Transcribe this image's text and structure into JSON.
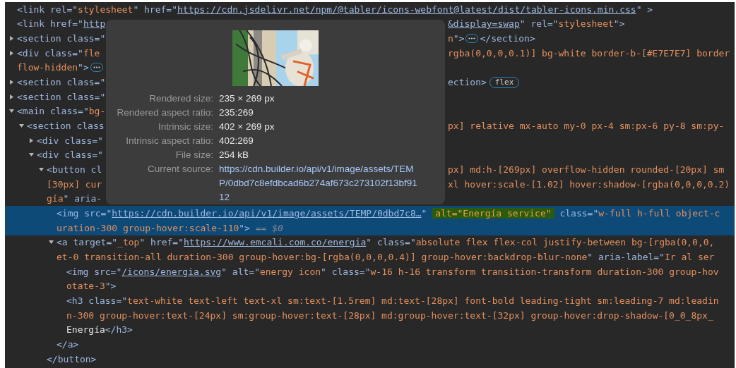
{
  "elements": [
    {
      "selected": false,
      "lines": [
        {
          "tokens": [
            {
              "kind": "markup",
              "text": "<link rel=\""
            },
            {
              "kind": "value",
              "text": "stylesheet"
            },
            {
              "kind": "markup",
              "text": "\" href=\""
            },
            {
              "kind": "link",
              "text": "https://cdn.jsdelivr.net/npm/@tabler/icons-webfont@latest/dist/tabler-icons.min.css"
            },
            {
              "kind": "markup",
              "text": "\" >"
            }
          ]
        }
      ]
    },
    {
      "selected": false,
      "lines": [
        {
          "left": [
            {
              "kind": "markup",
              "text": "<link href=\""
            },
            {
              "kind": "link",
              "text": "http"
            }
          ],
          "right": [
            {
              "kind": "link",
              "text": "&display=swap"
            },
            {
              "kind": "markup",
              "text": "\" rel=\""
            },
            {
              "kind": "value",
              "text": "stylesheet"
            },
            {
              "kind": "markup",
              "text": "\">"
            }
          ]
        }
      ]
    },
    {
      "selected": false,
      "expanded": false,
      "lines": [
        {
          "left": [
            {
              "kind": "markup",
              "text": "<section class=\""
            }
          ],
          "right": [
            {
              "kind": "value",
              "text": "n"
            },
            {
              "kind": "markup",
              "text": "\">"
            },
            {
              "kind": "more"
            },
            {
              "kind": "markup",
              "text": "</section>"
            }
          ]
        }
      ]
    },
    {
      "selected": false,
      "expanded": false,
      "lines": [
        {
          "left": [
            {
              "kind": "markup",
              "text": "<div class=\""
            },
            {
              "kind": "value",
              "text": "fle"
            }
          ],
          "right": [
            {
              "kind": "value",
              "text": "rgba(0,0,0,0.1)] bg-white border-b-[#E7E7E7] border"
            }
          ]
        },
        {
          "tokens": [
            {
              "kind": "value",
              "text": "flow-hidden"
            },
            {
              "kind": "markup",
              "text": "\">"
            },
            {
              "kind": "more"
            }
          ]
        }
      ]
    },
    {
      "selected": false,
      "expanded": false,
      "lines": [
        {
          "left": [
            {
              "kind": "markup",
              "text": "<section class=\""
            }
          ],
          "right": [
            {
              "kind": "markup",
              "text": "ection>"
            },
            {
              "kind": "badge",
              "text": "flex"
            }
          ]
        }
      ]
    },
    {
      "selected": false,
      "expanded": false,
      "lines": [
        {
          "left": [
            {
              "kind": "markup",
              "text": "<section class=\""
            }
          ]
        }
      ]
    },
    {
      "selected": false,
      "expanded": true,
      "lines": [
        {
          "left": [
            {
              "kind": "markup",
              "text": "<main class=\""
            },
            {
              "kind": "value",
              "text": "bg-"
            }
          ]
        }
      ],
      "children": [
        {
          "selected": false,
          "expanded": true,
          "lines": [
            {
              "left": [
                {
                  "kind": "markup",
                  "text": "<section class"
                }
              ],
              "right": [
                {
                  "kind": "value",
                  "text": "px] relative mx-auto my-0 px-4 sm:px-6 py-8 sm:py-"
                }
              ]
            }
          ],
          "children": [
            {
              "selected": false,
              "expanded": false,
              "lines": [
                {
                  "left": [
                    {
                      "kind": "markup",
                      "text": "<div class=\""
                    }
                  ]
                }
              ]
            },
            {
              "selected": false,
              "expanded": true,
              "lines": [
                {
                  "left": [
                    {
                      "kind": "markup",
                      "text": "<div class=\""
                    }
                  ]
                }
              ],
              "children": [
                {
                  "selected": false,
                  "expanded": true,
                  "lines": [
                    {
                      "left": [
                        {
                          "kind": "markup",
                          "text": "<button cl"
                        }
                      ],
                      "right": [
                        {
                          "kind": "value",
                          "text": "px] md:h-[269px] overflow-hidden rounded-[20px] sm"
                        }
                      ]
                    },
                    {
                      "left": [
                        {
                          "kind": "value",
                          "text": "[30px] cur"
                        }
                      ],
                      "right": [
                        {
                          "kind": "value",
                          "text": "xl hover:scale-[1.02] hover:shadow-[rgba(0,0,0,0.2)"
                        }
                      ]
                    },
                    {
                      "left": [
                        {
                          "kind": "value",
                          "text": "gía"
                        },
                        {
                          "kind": "markup",
                          "text": "\" aria-"
                        }
                      ]
                    }
                  ],
                  "children": [
                    {
                      "selected": true,
                      "lines": [
                        {
                          "tokens": [
                            {
                              "kind": "markup",
                              "text": "<img src=\""
                            },
                            {
                              "kind": "link",
                              "text": "https://cdn.builder.io/api/v1/image/assets/TEMP/0dbd7c8…"
                            },
                            {
                              "kind": "markup",
                              "text": "\" "
                            },
                            {
                              "kind": "highlight",
                              "text": "alt=\"Energía service\""
                            },
                            {
                              "kind": "markup",
                              "text": " class=\""
                            },
                            {
                              "kind": "value",
                              "text": "w-full h-full object-c"
                            }
                          ]
                        },
                        {
                          "tokens": [
                            {
                              "kind": "value",
                              "text": "uration-300 group-hover:scale-110"
                            },
                            {
                              "kind": "markup",
                              "text": "\">"
                            },
                            {
                              "kind": "dim",
                              "text": " == $0"
                            }
                          ]
                        }
                      ]
                    },
                    {
                      "selected": false,
                      "expanded": true,
                      "lines": [
                        {
                          "tokens": [
                            {
                              "kind": "markup",
                              "text": "<a target=\""
                            },
                            {
                              "kind": "value",
                              "text": "_top"
                            },
                            {
                              "kind": "markup",
                              "text": "\" href=\""
                            },
                            {
                              "kind": "link",
                              "text": "https://www.emcali.com.co/energia"
                            },
                            {
                              "kind": "markup",
                              "text": "\" class=\""
                            },
                            {
                              "kind": "value",
                              "text": "absolute flex flex-col justify-between bg-[rgba(0,0,0,"
                            }
                          ]
                        },
                        {
                          "tokens": [
                            {
                              "kind": "value",
                              "text": "et-0 transition-all duration-300 group-hover:bg-[rgba(0,0,0,0.4)] group-hover:backdrop-blur-none"
                            },
                            {
                              "kind": "markup",
                              "text": "\" aria-label=\""
                            },
                            {
                              "kind": "value",
                              "text": "Ir al ser"
                            }
                          ]
                        }
                      ],
                      "children": [
                        {
                          "selected": false,
                          "lines": [
                            {
                              "tokens": [
                                {
                                  "kind": "markup",
                                  "text": "<img src=\""
                                },
                                {
                                  "kind": "link",
                                  "text": "/icons/energia.svg"
                                },
                                {
                                  "kind": "markup",
                                  "text": "\" alt=\""
                                },
                                {
                                  "kind": "value",
                                  "text": "energy icon"
                                },
                                {
                                  "kind": "markup",
                                  "text": "\" class=\""
                                },
                                {
                                  "kind": "value",
                                  "text": "w-16 h-16 transform transition-transform duration-300 group-hov"
                                }
                              ]
                            },
                            {
                              "tokens": [
                                {
                                  "kind": "value",
                                  "text": "otate-3"
                                },
                                {
                                  "kind": "markup",
                                  "text": "\">"
                                }
                              ]
                            }
                          ]
                        },
                        {
                          "selected": false,
                          "lines": [
                            {
                              "tokens": [
                                {
                                  "kind": "markup",
                                  "text": "<h3 class=\""
                                },
                                {
                                  "kind": "value",
                                  "text": "text-white text-left text-xl sm:text-[1.5rem] md:text-[28px] font-bold leading-tight sm:leading-7 md:leadin"
                                }
                              ]
                            },
                            {
                              "tokens": [
                                {
                                  "kind": "value",
                                  "text": "n-300 group-hover:text-[24px] sm:group-hover:text-[28px] md:group-hover:text-[32px] group-hover:drop-shadow-[0_0_8px_"
                                }
                              ]
                            },
                            {
                              "tokens": [
                                {
                                  "kind": "text",
                                  "text": "Energía"
                                },
                                {
                                  "kind": "markup",
                                  "text": "</h3>"
                                }
                              ]
                            }
                          ]
                        }
                      ],
                      "closing": [
                        {
                          "kind": "markup",
                          "text": "</a>"
                        }
                      ]
                    }
                  ],
                  "closing": [
                    {
                      "kind": "markup",
                      "text": "</button>"
                    }
                  ]
                }
              ]
            }
          ]
        }
      ]
    }
  ],
  "tooltip": {
    "rows": [
      {
        "label": "Rendered size:",
        "value": "235 × 269 px"
      },
      {
        "label": "Rendered aspect ratio:",
        "value": "235:269"
      },
      {
        "label": "Intrinsic size:",
        "value": "402 × 269 px"
      },
      {
        "label": "Intrinsic aspect ratio:",
        "value": "402:269"
      },
      {
        "label": "File size:",
        "value": "254 kB"
      },
      {
        "label": "Current source:",
        "value": "https://cdn.builder.io/api/v1/image/assets/TEMP/0dbd7c8efdbcad6b274af673c273102f13bf9112",
        "kind": "link"
      }
    ]
  }
}
